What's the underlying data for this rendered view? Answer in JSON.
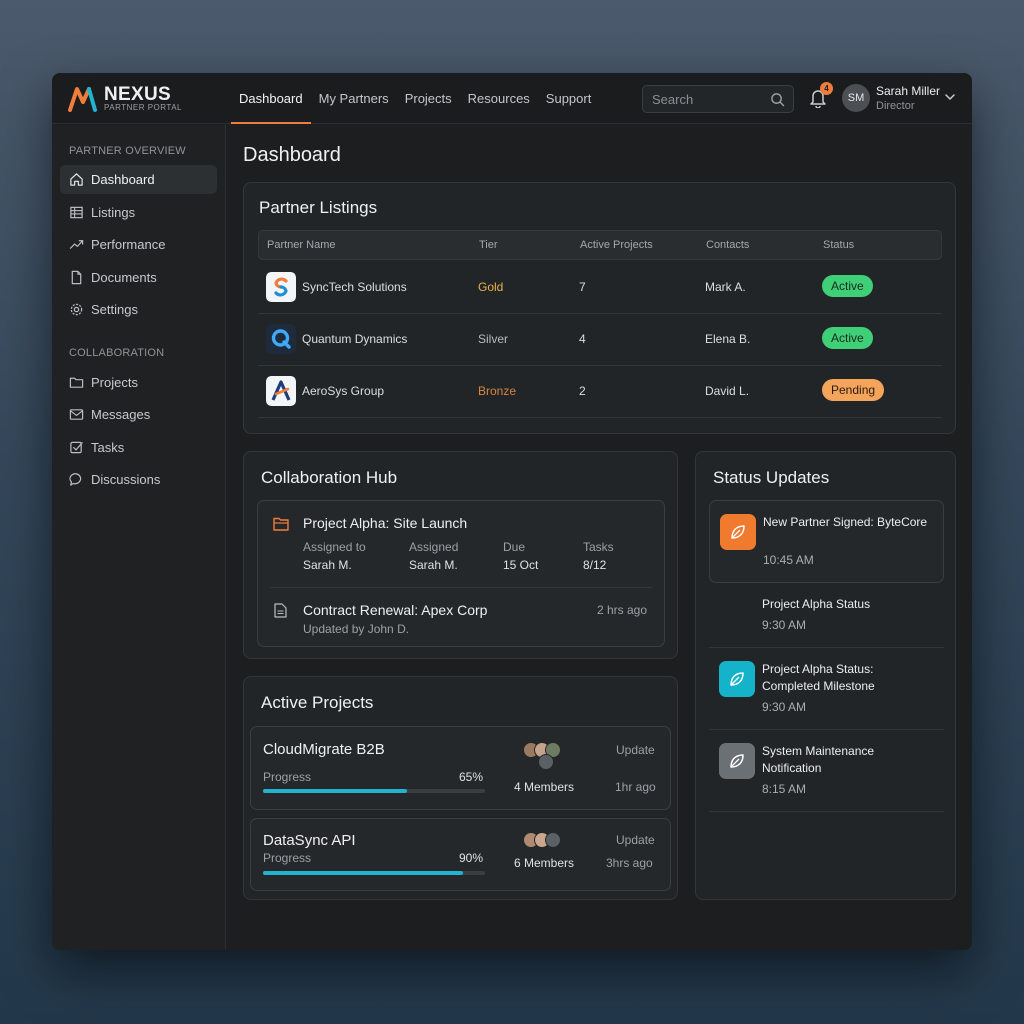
{
  "app": {
    "name": "NEXUS",
    "subtitle": "PARTNER PORTAL"
  },
  "nav": [
    "Dashboard",
    "My Partners",
    "Projects",
    "Resources",
    "Support"
  ],
  "search": {
    "placeholder": "Search"
  },
  "notifications": {
    "count": "4"
  },
  "user": {
    "initials": "SM",
    "name": "Sarah Miller",
    "role": "Director"
  },
  "sidebar": {
    "section1": "PARTNER OVERVIEW",
    "items1": [
      "Dashboard",
      "Listings",
      "Performance",
      "Documents",
      "Settings"
    ],
    "section2": "COLLABORATION",
    "items2": [
      "Projects",
      "Messages",
      "Tasks",
      "Discussions"
    ]
  },
  "page": {
    "title": "Dashboard"
  },
  "listings": {
    "title": "Partner Listings",
    "headers": [
      "Partner Name",
      "Tier",
      "Active Projects",
      "Contacts",
      "Status"
    ],
    "rows": [
      {
        "name": "SyncTech Solutions",
        "tier": "Gold",
        "projects": "7",
        "contact": "Mark A.",
        "status": "Active"
      },
      {
        "name": "Quantum Dynamics",
        "tier": "Silver",
        "projects": "4",
        "contact": "Elena B.",
        "status": "Active"
      },
      {
        "name": "AeroSys Group",
        "tier": "Bronze",
        "projects": "2",
        "contact": "David L.",
        "status": "Pending"
      }
    ]
  },
  "hub": {
    "title": "Collaboration Hub",
    "project": {
      "name": "Project Alpha: Site Launch",
      "fields": [
        {
          "label": "Assigned to",
          "value": "Sarah M."
        },
        {
          "label": "Assigned",
          "value": "Sarah M."
        },
        {
          "label": "Due",
          "value": "15 Oct"
        },
        {
          "label": "Tasks",
          "value": "8/12"
        }
      ]
    },
    "doc": {
      "name": "Contract Renewal: Apex Corp",
      "sub": "Updated by John D.",
      "time": "2 hrs ago"
    }
  },
  "active_projects": {
    "title": "Active Projects",
    "items": [
      {
        "name": "CloudMigrate B2B",
        "progress_label": "Progress",
        "percent_text": "65%",
        "progress": 0.65,
        "members": "4 Members",
        "update_label": "Update",
        "update_time": "1hr ago"
      },
      {
        "name": "DataSync API",
        "progress_label": "Progress",
        "percent_text": "90%",
        "progress": 0.9,
        "members": "6 Members",
        "update_label": "Update",
        "update_time": "3hrs ago"
      }
    ]
  },
  "status_updates": {
    "title": "Status Updates",
    "items": [
      {
        "title": "New Partner Signed: ByteCore",
        "time": "10:45 AM",
        "icon": "leaf-icon",
        "color": "#f07a2e"
      },
      {
        "title": "Project Alpha Status",
        "time": "9:30 AM",
        "icon": "",
        "color": ""
      },
      {
        "title": "Project Alpha Status: Completed Milestone",
        "time": "9:30 AM",
        "icon": "leaf-icon",
        "color": "#15b3c9"
      },
      {
        "title": "System Maintenance Notification",
        "time": "8:15 AM",
        "icon": "leaf-icon",
        "color": "#6b7075"
      }
    ]
  },
  "colors": {
    "accent": "#ef7d3c",
    "gold": "#e8b04a",
    "silver": "#b8bcc0",
    "bronze": "#d9843f",
    "active": "#3ecf77",
    "pending": "#f5a45b",
    "progress": "#22b3cf"
  }
}
